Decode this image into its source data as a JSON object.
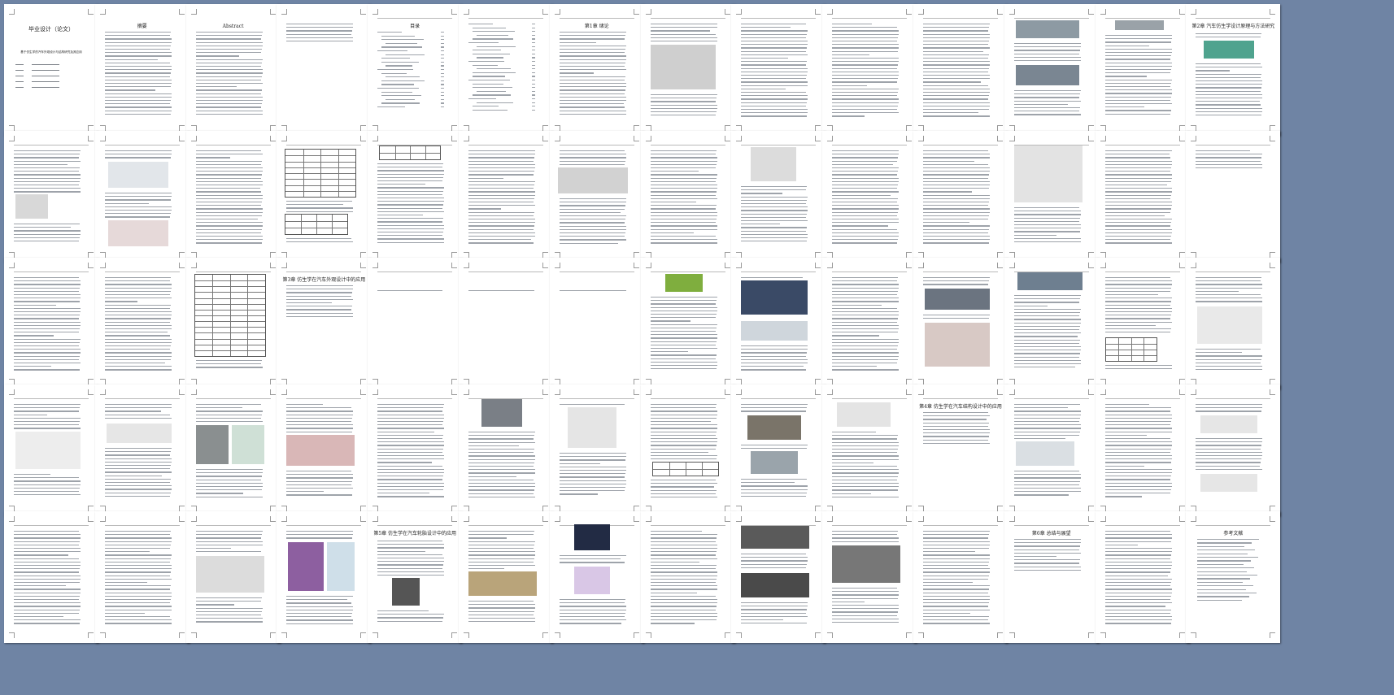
{
  "document": {
    "cover": {
      "title": "毕业设计（论文）",
      "subtitle": "基于仿生学的汽车外观设计与结构研究及其应用"
    },
    "section_titles": {
      "abstract_cn": "摘要",
      "abstract_en": "Abstract",
      "contents": "目录",
      "chapter1": "第1章 绪论",
      "chapter2": "第2章 汽车仿生学设计原理与方法研究",
      "chapter3": "第3章 仿生学在汽车外观设计中的应用",
      "chapter4": "第4章 仿生学在汽车结构设计中的应用",
      "chapter5": "第5章 仿生学在汽车轮胎设计中的应用",
      "conclusion": "第6章 总结与展望",
      "references": "参考文献"
    }
  },
  "layout_hints": {
    "rows": 5,
    "columns": 14,
    "page_count": 70
  }
}
